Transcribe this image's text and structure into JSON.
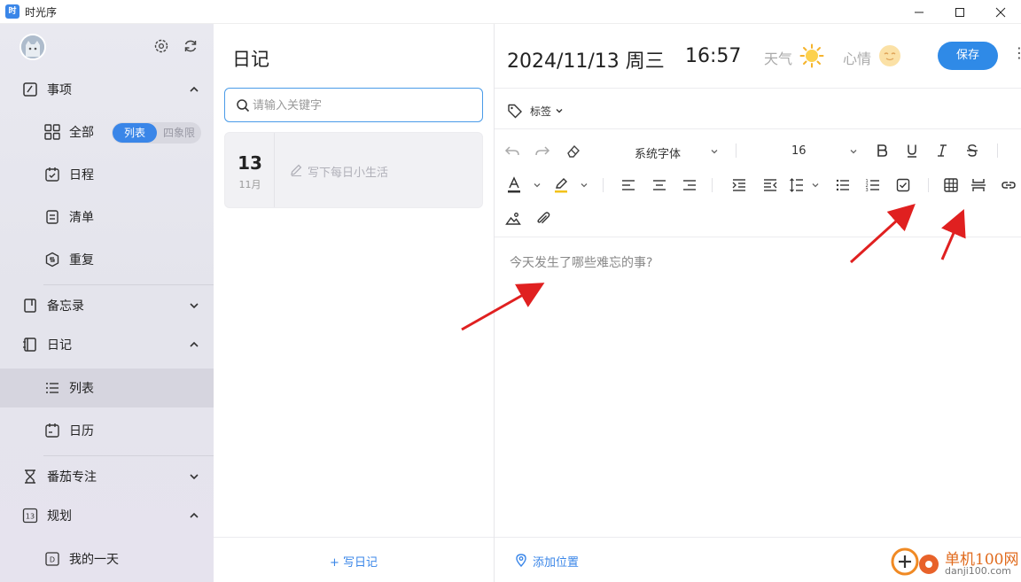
{
  "window": {
    "title": "时光序",
    "app_icon_text": "时"
  },
  "sidebar": {
    "groups": [
      {
        "label": "事项",
        "icon": "todo-icon",
        "expanded": true
      },
      {
        "label": "备忘录",
        "icon": "memo-icon",
        "expanded": false
      },
      {
        "label": "日记",
        "icon": "diary-icon",
        "expanded": true
      },
      {
        "label": "番茄专注",
        "icon": "hourglass-icon",
        "expanded": false
      },
      {
        "label": "规划",
        "icon": "calendar-13-icon",
        "expanded": true
      }
    ],
    "todo_items": [
      {
        "label": "全部",
        "icon": "grid-icon"
      },
      {
        "label": "日程",
        "icon": "calendar-check-icon"
      },
      {
        "label": "清单",
        "icon": "list-doc-icon"
      },
      {
        "label": "重复",
        "icon": "repeat-icon"
      }
    ],
    "view_toggle": {
      "list": "列表",
      "quadrant": "四象限",
      "selected": "list"
    },
    "diary_items": [
      {
        "label": "列表",
        "icon": "list-icon",
        "active": true
      },
      {
        "label": "日历",
        "icon": "calendar-icon",
        "active": false
      }
    ],
    "plan_items": [
      {
        "label": "我的一天",
        "icon": "day-icon"
      }
    ],
    "plan_icon_text": "13",
    "my_day_icon_text": "D"
  },
  "list_panel": {
    "title": "日记",
    "search_placeholder": "请输入关键字",
    "entry": {
      "day": "13",
      "month": "11月",
      "placeholder": "写下每日小生活"
    },
    "write_button": "+ 写日记"
  },
  "editor": {
    "date": "2024/11/13 周三",
    "time": "16:57",
    "weather_label": "天气",
    "mood_label": "心情",
    "save_label": "保存",
    "more_label": "⋮",
    "tag_label": "标签",
    "font_name": "系统字体",
    "font_size": "16",
    "content_placeholder": "今天发生了哪些难忘的事?",
    "add_location": "添加位置"
  },
  "watermark": {
    "text1": "单机100网",
    "text2": "danji100.com"
  },
  "colors": {
    "accent": "#3a86e8",
    "arrow": "#e02020",
    "save_button": "#2f8ae7"
  }
}
